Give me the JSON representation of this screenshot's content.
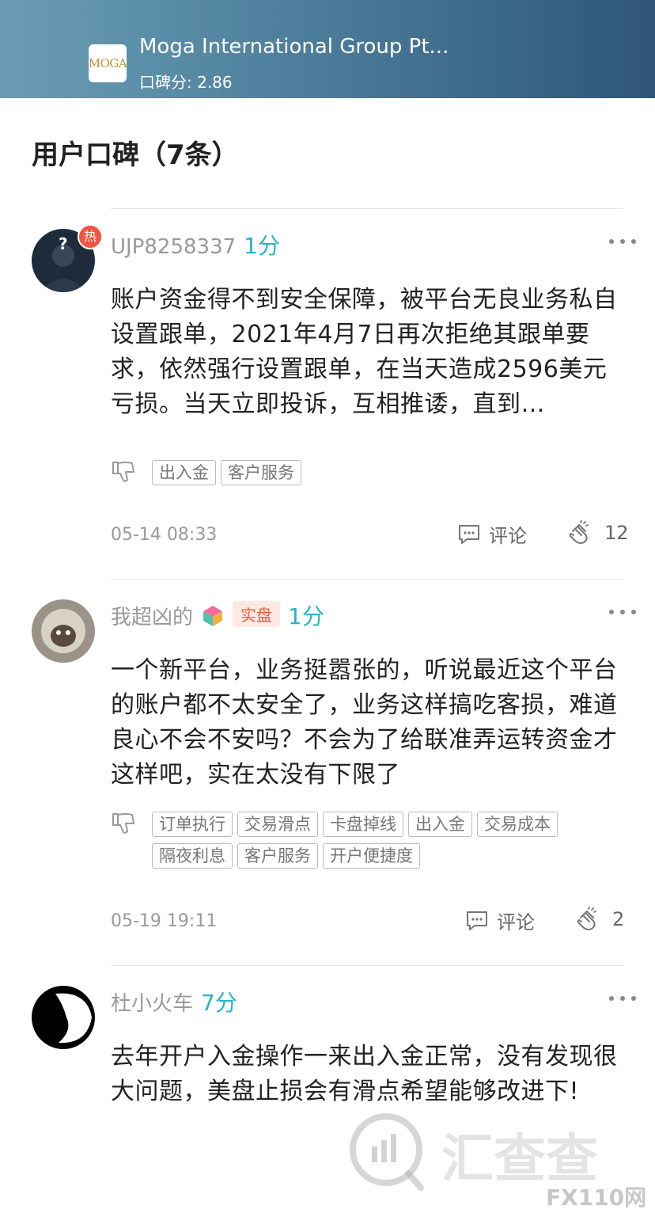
{
  "header": {
    "logo_text": "MOGA",
    "company_name": "Moga International Group Pt...",
    "score": "口碑分: 2.86"
  },
  "section_title": "用户口碑（7条）",
  "reviews": [
    {
      "username": "UJP8258337",
      "points": "1分",
      "hot_badge": "热",
      "text": "账户资金得不到安全保障，被平台无良业务私自设置跟单，2021年4月7日再次拒绝其跟单要求，依然强行设置跟单，在当天造成2596美元亏损。当天立即投诉，互相推诿，直到…",
      "tags": [
        "出入金",
        "客户服务"
      ],
      "time": "05-14 08:33",
      "comment_label": "评论",
      "clap_count": "12"
    },
    {
      "username": "我超凶的",
      "real_badge": "实盘",
      "points": "1分",
      "text": "一个新平台，业务挺嚣张的，听说最近这个平台的账户都不太安全了，业务这样搞吃客损，难道良心不会不安吗？不会为了给联准弄运转资金才这样吧，实在太没有下限了",
      "tags": [
        "订单执行",
        "交易滑点",
        "卡盘掉线",
        "出入金",
        "交易成本",
        "隔夜利息",
        "客户服务",
        "开户便捷度"
      ],
      "time": "05-19 19:11",
      "comment_label": "评论",
      "clap_count": "2"
    },
    {
      "username": "杜小火车",
      "points": "7分",
      "text": "去年开户入金操作一来出入金正常，没有发现很大问题，美盘止损会有滑点希望能够改进下!"
    }
  ],
  "watermark": {
    "brand": "汇查查",
    "site": "FX110网"
  },
  "colors": {
    "points": "#2ab4c8",
    "hot": "#f1543f",
    "real_badge": "#ee5a3b"
  }
}
